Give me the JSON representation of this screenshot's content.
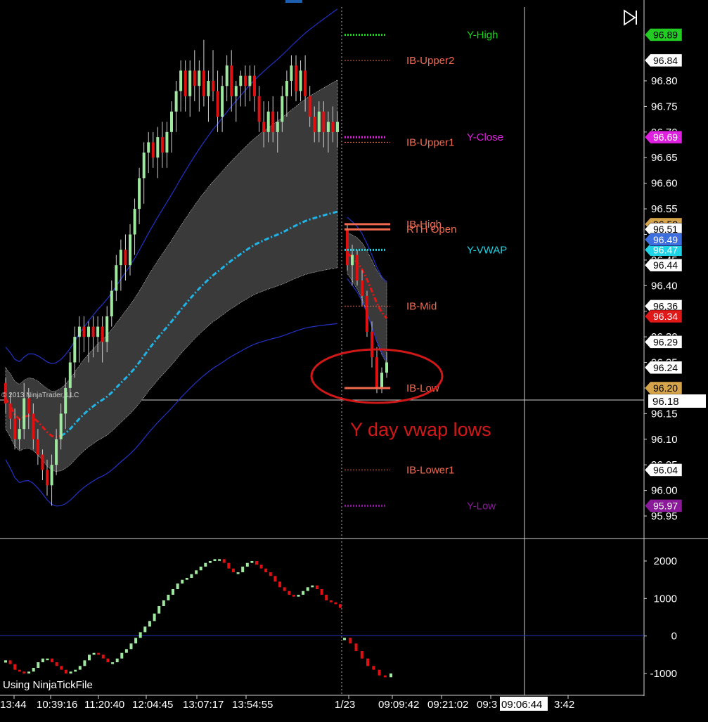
{
  "copyright": "© 2013 NinjaTrader, LLC",
  "tick_source": "Using NinjaTickFile",
  "annotation": "Y day vwap lows",
  "session_marker": "1/23",
  "crosshair_time": "09:06:44",
  "colors": {
    "background": "#000000",
    "up_bar": "#9fe89f",
    "down_bar": "#e01010",
    "band_fill": "#3a3a3a",
    "vwap_blue": "#1fb3e6",
    "vwap_red": "#e01818",
    "envelope": "#2232c8",
    "annotation_red": "#d01818"
  },
  "levels": [
    {
      "label": "Y-High",
      "color": "#19d119",
      "value": 96.89,
      "tag": "96.89",
      "tag_bg": "#22cc22",
      "tag_fg": "#000000",
      "style": "dotted"
    },
    {
      "label": "IB-Upper2",
      "color": "#f06a50",
      "value": 96.84,
      "tag": "96.84",
      "tag_bg": "#ffffff",
      "tag_fg": "#000000",
      "style": "dashed"
    },
    {
      "label": "Y-Close",
      "color": "#e020e0",
      "value": 96.69,
      "tag": "96.69",
      "tag_bg": "#e020e0",
      "tag_fg": "#ffffff",
      "style": "dotted"
    },
    {
      "label": "IB-Upper1",
      "color": "#f06a50",
      "value": 96.68,
      "tag": "",
      "tag_bg": "#ffffff",
      "tag_fg": "#000000",
      "style": "dashed"
    },
    {
      "label": "IB-High",
      "color": "#f06a50",
      "value": 96.52,
      "tag": "96.52",
      "tag_bg": "#d4a34a",
      "tag_fg": "#000000",
      "style": "solid"
    },
    {
      "label": "RTH Open",
      "color": "#f06a50",
      "value": 96.51,
      "tag": "96.51",
      "tag_bg": "#ffffff",
      "tag_fg": "#000000",
      "style": "solid"
    },
    {
      "label": "Y-VWAP",
      "color": "#1fd4e6",
      "value": 96.47,
      "tag": "96.47",
      "tag_bg": "#1fd4e6",
      "tag_fg": "#ffffff",
      "style": "dotted"
    },
    {
      "label": "IB-Mid",
      "color": "#f06a50",
      "value": 96.36,
      "tag": "96.36",
      "tag_bg": "#ffffff",
      "tag_fg": "#000000",
      "style": "dashed"
    },
    {
      "label": "IB-Low",
      "color": "#f06a50",
      "value": 96.2,
      "tag": "96.20",
      "tag_bg": "#d4a34a",
      "tag_fg": "#000000",
      "style": "solid"
    },
    {
      "label": "IB-Lower1",
      "color": "#f06a50",
      "value": 96.04,
      "tag": "96.04",
      "tag_bg": "#ffffff",
      "tag_fg": "#000000",
      "style": "dashed"
    },
    {
      "label": "Y-Low",
      "color": "#8a1a9a",
      "value": 95.97,
      "tag": "95.97",
      "tag_bg": "#8a1a9a",
      "tag_fg": "#ffffff",
      "style": "dotted"
    }
  ],
  "extra_tags": [
    {
      "tag": "96.49",
      "value": 96.49,
      "bg": "#3c6ee0",
      "fg": "#ffffff"
    },
    {
      "tag": "96.44",
      "value": 96.44,
      "bg": "#ffffff",
      "fg": "#000000"
    },
    {
      "tag": "96.34",
      "value": 96.34,
      "bg": "#e01818",
      "fg": "#ffffff"
    },
    {
      "tag": "96.29",
      "value": 96.29,
      "bg": "#ffffff",
      "fg": "#000000"
    },
    {
      "tag": "96.24",
      "value": 96.24,
      "bg": "#ffffff",
      "fg": "#000000"
    }
  ],
  "cursor_tag": "96.18",
  "chart_data": [
    {
      "type": "candlestick",
      "title": "",
      "ylim": [
        95.93,
        96.92
      ],
      "y_ticks": [
        96.8,
        96.75,
        96.7,
        96.65,
        96.6,
        96.55,
        96.5,
        96.45,
        96.4,
        96.35,
        96.3,
        96.25,
        96.2,
        96.15,
        96.1,
        96.05,
        96.0,
        95.95
      ],
      "y_tick_labels": [
        "96.80",
        "96.75",
        "96.70",
        "96.65",
        "96.60",
        "96.55",
        "96.50",
        "96.45",
        "96.40",
        "96.35",
        "96.30",
        "96.25",
        "96.20",
        "96.15",
        "96.10",
        "96.05",
        "96.00",
        "95.95"
      ],
      "x_tick_labels": [
        "13:44",
        "10:39:16",
        "11:20:40",
        "12:04:45",
        "13:07:17",
        "13:54:55",
        "1/23",
        "09:09:42",
        "09:21:02",
        "09:3",
        "3:42"
      ],
      "crosshair_price": 96.18,
      "bars_session1": [
        [
          96.21,
          96.22,
          96.15,
          96.17
        ],
        [
          96.17,
          96.19,
          96.12,
          96.14
        ],
        [
          96.14,
          96.16,
          96.08,
          96.1
        ],
        [
          96.1,
          96.14,
          96.08,
          96.12
        ],
        [
          96.12,
          96.21,
          96.1,
          96.18
        ],
        [
          96.18,
          96.2,
          96.12,
          96.15
        ],
        [
          96.15,
          96.17,
          96.08,
          96.1
        ],
        [
          96.1,
          96.12,
          96.05,
          96.07
        ],
        [
          96.07,
          96.08,
          96.02,
          96.04
        ],
        [
          96.04,
          96.06,
          95.99,
          96.01
        ],
        [
          96.01,
          96.07,
          95.97,
          96.05
        ],
        [
          96.05,
          96.12,
          96.03,
          96.1
        ],
        [
          96.1,
          96.17,
          96.08,
          96.15
        ],
        [
          96.15,
          96.22,
          96.12,
          96.2
        ],
        [
          96.2,
          96.27,
          96.18,
          96.25
        ],
        [
          96.25,
          96.32,
          96.22,
          96.3
        ],
        [
          96.3,
          96.34,
          96.25,
          96.32
        ],
        [
          96.32,
          96.34,
          96.27,
          96.3
        ],
        [
          96.3,
          96.33,
          96.25,
          96.32
        ],
        [
          96.32,
          96.34,
          96.26,
          96.3
        ],
        [
          96.3,
          96.34,
          96.27,
          96.32
        ],
        [
          96.32,
          96.34,
          96.25,
          96.29
        ],
        [
          96.29,
          96.36,
          96.27,
          96.34
        ],
        [
          96.34,
          96.41,
          96.32,
          96.39
        ],
        [
          96.39,
          96.46,
          96.37,
          96.44
        ],
        [
          96.44,
          96.49,
          96.39,
          96.47
        ],
        [
          96.47,
          96.5,
          96.41,
          96.44
        ],
        [
          96.44,
          96.52,
          96.42,
          96.5
        ],
        [
          96.5,
          96.57,
          96.46,
          96.55
        ],
        [
          96.55,
          96.63,
          96.52,
          96.61
        ],
        [
          96.61,
          96.68,
          96.56,
          96.66
        ],
        [
          96.66,
          96.7,
          96.62,
          96.68
        ],
        [
          96.68,
          96.7,
          96.63,
          96.65
        ],
        [
          96.65,
          96.71,
          96.61,
          96.69
        ],
        [
          96.69,
          96.72,
          96.63,
          96.66
        ],
        [
          96.66,
          96.72,
          96.63,
          96.7
        ],
        [
          96.7,
          96.76,
          96.66,
          96.74
        ],
        [
          96.74,
          96.8,
          96.7,
          96.78
        ],
        [
          96.78,
          96.84,
          96.74,
          96.82
        ],
        [
          96.82,
          96.84,
          96.74,
          96.77
        ],
        [
          96.77,
          96.84,
          96.73,
          96.82
        ],
        [
          96.82,
          96.86,
          96.76,
          96.79
        ],
        [
          96.79,
          96.84,
          96.74,
          96.82
        ],
        [
          96.82,
          96.88,
          96.75,
          96.77
        ],
        [
          96.77,
          96.82,
          96.72,
          96.8
        ],
        [
          96.8,
          96.86,
          96.76,
          96.78
        ],
        [
          96.78,
          96.82,
          96.7,
          96.73
        ],
        [
          96.73,
          96.81,
          96.7,
          96.79
        ],
        [
          96.79,
          96.85,
          96.76,
          96.83
        ],
        [
          96.83,
          96.86,
          96.74,
          96.77
        ],
        [
          96.77,
          96.8,
          96.72,
          96.79
        ],
        [
          96.79,
          96.82,
          96.75,
          96.81
        ],
        [
          96.81,
          96.83,
          96.75,
          96.79
        ],
        [
          96.79,
          96.83,
          96.76,
          96.81
        ],
        [
          96.81,
          96.83,
          96.74,
          96.77
        ],
        [
          96.77,
          96.79,
          96.7,
          96.72
        ],
        [
          96.72,
          96.76,
          96.67,
          96.7
        ],
        [
          96.7,
          96.76,
          96.68,
          96.74
        ],
        [
          96.74,
          96.77,
          96.68,
          96.7
        ],
        [
          96.7,
          96.74,
          96.66,
          96.72
        ],
        [
          96.72,
          96.79,
          96.7,
          96.77
        ],
        [
          96.77,
          96.82,
          96.73,
          96.8
        ],
        [
          96.8,
          96.85,
          96.77,
          96.83
        ],
        [
          96.83,
          96.85,
          96.76,
          96.78
        ],
        [
          96.78,
          96.84,
          96.76,
          96.82
        ],
        [
          96.82,
          96.85,
          96.74,
          96.77
        ],
        [
          96.77,
          96.79,
          96.71,
          96.73
        ],
        [
          96.73,
          96.75,
          96.68,
          96.7
        ],
        [
          96.7,
          96.76,
          96.68,
          96.74
        ],
        [
          96.74,
          96.76,
          96.67,
          96.7
        ],
        [
          96.7,
          96.74,
          96.66,
          96.72
        ],
        [
          96.72,
          96.75,
          96.68,
          96.7
        ],
        [
          96.7,
          96.74,
          96.67,
          96.72
        ]
      ],
      "bars_session2": [
        [
          96.51,
          96.52,
          96.43,
          96.44
        ],
        [
          96.44,
          96.48,
          96.4,
          96.46
        ],
        [
          96.46,
          96.47,
          96.4,
          96.41
        ],
        [
          96.41,
          96.43,
          96.36,
          96.38
        ],
        [
          96.38,
          96.39,
          96.3,
          96.31
        ],
        [
          96.31,
          96.33,
          96.24,
          96.26
        ],
        [
          96.26,
          96.28,
          96.19,
          96.2
        ],
        [
          96.2,
          96.24,
          96.19,
          96.23
        ],
        [
          96.23,
          96.27,
          96.22,
          96.25
        ]
      ]
    },
    {
      "type": "bar",
      "title": "",
      "ylim": [
        -1200,
        2300
      ],
      "y_ticks": [
        2000,
        1000,
        0,
        -1000
      ],
      "y_tick_labels": [
        "2000",
        "1000",
        "0",
        "-1000"
      ],
      "session1": [
        -650,
        -750,
        -900,
        -950,
        -1000,
        -950,
        -850,
        -700,
        -600,
        -600,
        -700,
        -800,
        -900,
        -1000,
        -950,
        -900,
        -800,
        -650,
        -500,
        -450,
        -500,
        -600,
        -700,
        -700,
        -600,
        -450,
        -350,
        -200,
        -50,
        100,
        250,
        400,
        600,
        800,
        950,
        1100,
        1250,
        1400,
        1500,
        1550,
        1650,
        1750,
        1850,
        1950,
        2000,
        2050,
        2050,
        1950,
        1800,
        1700,
        1700,
        1850,
        1950,
        2000,
        1900,
        1800,
        1700,
        1600,
        1450,
        1300,
        1200,
        1100,
        1050,
        1100,
        1200,
        1300,
        1350,
        1250,
        1100,
        950,
        900,
        850,
        750
      ],
      "session2": [
        -50,
        -200,
        -400,
        -600,
        -800,
        -900,
        -1050,
        -1100,
        -1000
      ]
    }
  ]
}
